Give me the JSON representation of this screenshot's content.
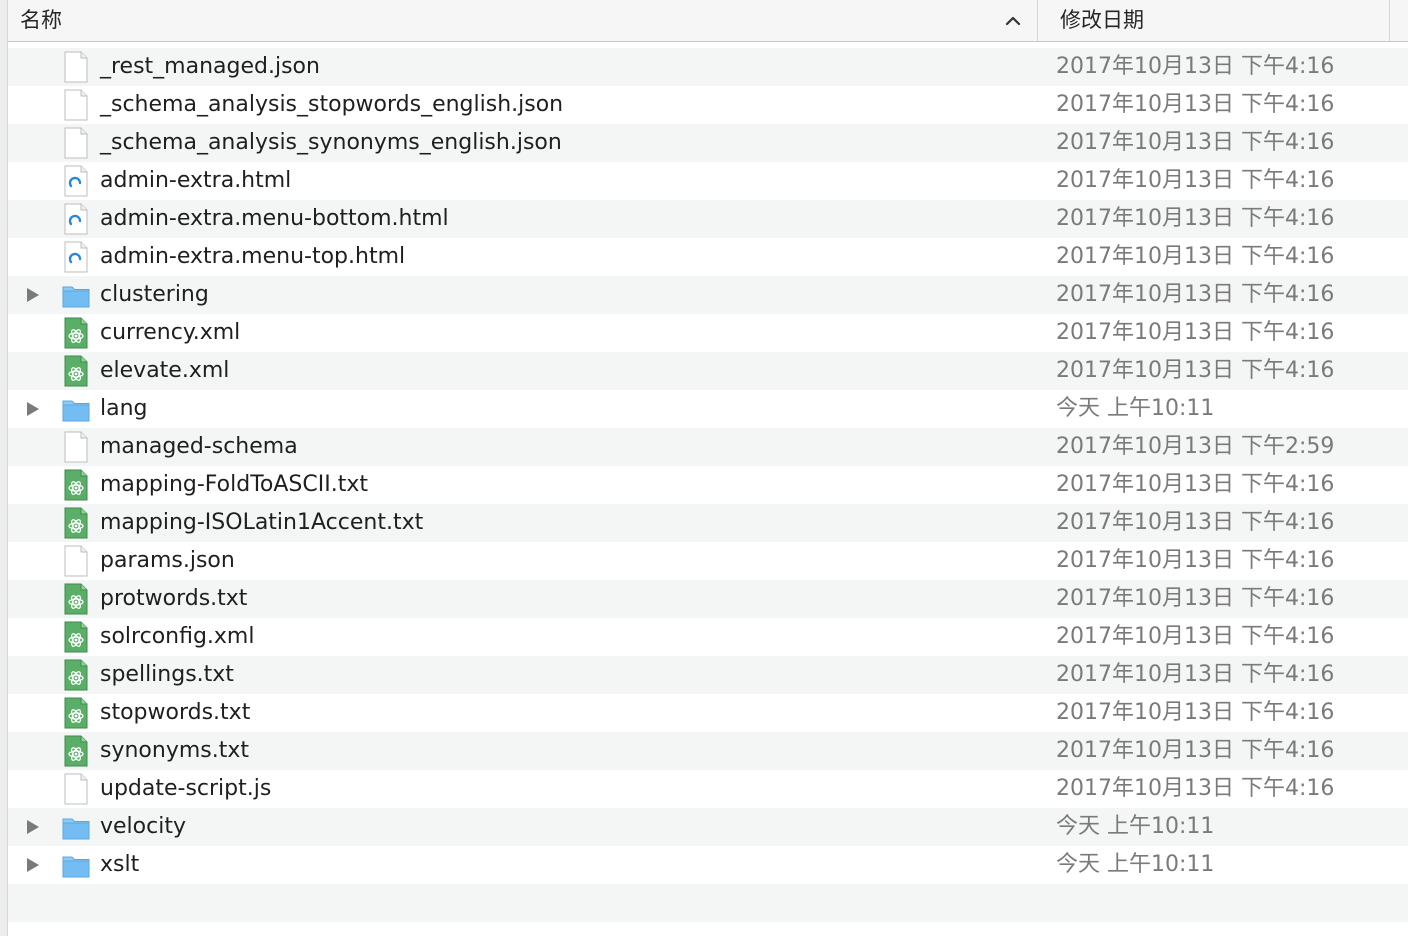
{
  "header": {
    "name_label": "名称",
    "date_label": "修改日期",
    "sort": "ascending"
  },
  "files": [
    {
      "name": "_rest_managed.json",
      "date": "2017年10月13日 下午4:16",
      "icon": "document-icon",
      "folder": false
    },
    {
      "name": "_schema_analysis_stopwords_english.json",
      "date": "2017年10月13日 下午4:16",
      "icon": "document-icon",
      "folder": false
    },
    {
      "name": "_schema_analysis_synonyms_english.json",
      "date": "2017年10月13日 下午4:16",
      "icon": "document-icon",
      "folder": false
    },
    {
      "name": "admin-extra.html",
      "date": "2017年10月13日 下午4:16",
      "icon": "html-icon",
      "folder": false
    },
    {
      "name": "admin-extra.menu-bottom.html",
      "date": "2017年10月13日 下午4:16",
      "icon": "html-icon",
      "folder": false
    },
    {
      "name": "admin-extra.menu-top.html",
      "date": "2017年10月13日 下午4:16",
      "icon": "html-icon",
      "folder": false
    },
    {
      "name": "clustering",
      "date": "2017年10月13日 下午4:16",
      "icon": "folder-icon",
      "folder": true
    },
    {
      "name": "currency.xml",
      "date": "2017年10月13日 下午4:16",
      "icon": "atom-icon",
      "folder": false
    },
    {
      "name": "elevate.xml",
      "date": "2017年10月13日 下午4:16",
      "icon": "atom-icon",
      "folder": false
    },
    {
      "name": "lang",
      "date": "今天 上午10:11",
      "icon": "folder-icon",
      "folder": true
    },
    {
      "name": "managed-schema",
      "date": "2017年10月13日 下午2:59",
      "icon": "document-icon",
      "folder": false
    },
    {
      "name": "mapping-FoldToASCII.txt",
      "date": "2017年10月13日 下午4:16",
      "icon": "atom-icon",
      "folder": false
    },
    {
      "name": "mapping-ISOLatin1Accent.txt",
      "date": "2017年10月13日 下午4:16",
      "icon": "atom-icon",
      "folder": false
    },
    {
      "name": "params.json",
      "date": "2017年10月13日 下午4:16",
      "icon": "document-icon",
      "folder": false
    },
    {
      "name": "protwords.txt",
      "date": "2017年10月13日 下午4:16",
      "icon": "atom-icon",
      "folder": false
    },
    {
      "name": "solrconfig.xml",
      "date": "2017年10月13日 下午4:16",
      "icon": "atom-icon",
      "folder": false
    },
    {
      "name": "spellings.txt",
      "date": "2017年10月13日 下午4:16",
      "icon": "atom-icon",
      "folder": false
    },
    {
      "name": "stopwords.txt",
      "date": "2017年10月13日 下午4:16",
      "icon": "atom-icon",
      "folder": false
    },
    {
      "name": "synonyms.txt",
      "date": "2017年10月13日 下午4:16",
      "icon": "atom-icon",
      "folder": false
    },
    {
      "name": "update-script.js",
      "date": "2017年10月13日 下午4:16",
      "icon": "document-icon",
      "folder": false
    },
    {
      "name": "velocity",
      "date": "今天 上午10:11",
      "icon": "folder-icon",
      "folder": true
    },
    {
      "name": "xslt",
      "date": "今天 上午10:11",
      "icon": "folder-icon",
      "folder": true
    }
  ],
  "colors": {
    "folder_blue": "#6cb8f0",
    "atom_green": "#4fa35f",
    "html_blue": "#2a86d8",
    "date_gray": "#7a7a7a",
    "stripe": "#f4f5f5"
  }
}
